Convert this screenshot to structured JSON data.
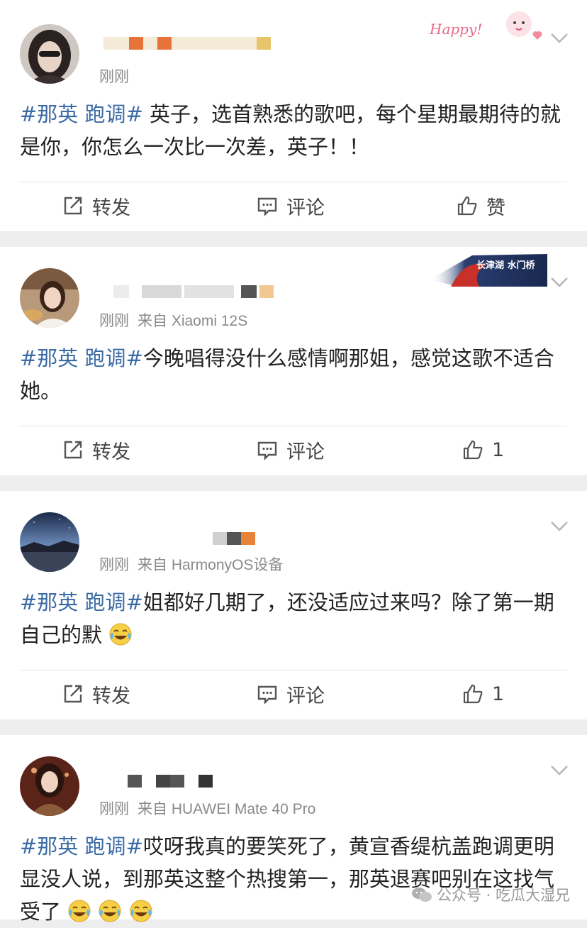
{
  "posts": [
    {
      "time": "刚刚",
      "source": "",
      "tag": "#那英 跑调#",
      "body": " 英子，选首熟悉的歌吧，每个星期最期待的就是你，你怎么一次比一次差，英子！！",
      "actions": {
        "repost": "转发",
        "comment": "评论",
        "like": "赞"
      },
      "deco_text": "Happy!"
    },
    {
      "time": "刚刚",
      "source": "来自 Xiaomi 12S",
      "tag": "#那英 跑调#",
      "body": "今晚唱得没什么感情啊那姐，感觉这歌不适合她。",
      "actions": {
        "repost": "转发",
        "comment": "评论",
        "like": "1"
      },
      "deco_text": "长津湖 水门桥"
    },
    {
      "time": "刚刚",
      "source": "来自 HarmonyOS设备",
      "tag": "#那英 跑调#",
      "body": "姐都好几期了，还没适应过来吗？除了第一期自己的默",
      "actions": {
        "repost": "转发",
        "comment": "评论",
        "like": "1"
      }
    },
    {
      "time": "刚刚",
      "source": "来自 HUAWEI Mate 40 Pro",
      "tag": "#那英 跑调#",
      "body": "哎呀我真的要笑死了，黄宣香缇杭盖跑调更明显没人说，到那英这整个热搜第一，那英退赛吧别在这找气受了",
      "actions": {}
    }
  ],
  "watermark": "公众号 · 吃瓜大湿兄",
  "colors": {
    "hashtag": "#3b6ba5",
    "meta": "#8a8a8a",
    "background": "#eeeeee"
  },
  "icons": [
    "repost-icon",
    "comment-icon",
    "like-icon",
    "chevron-down-icon",
    "laugh-cry-emoji",
    "wechat-icon"
  ]
}
